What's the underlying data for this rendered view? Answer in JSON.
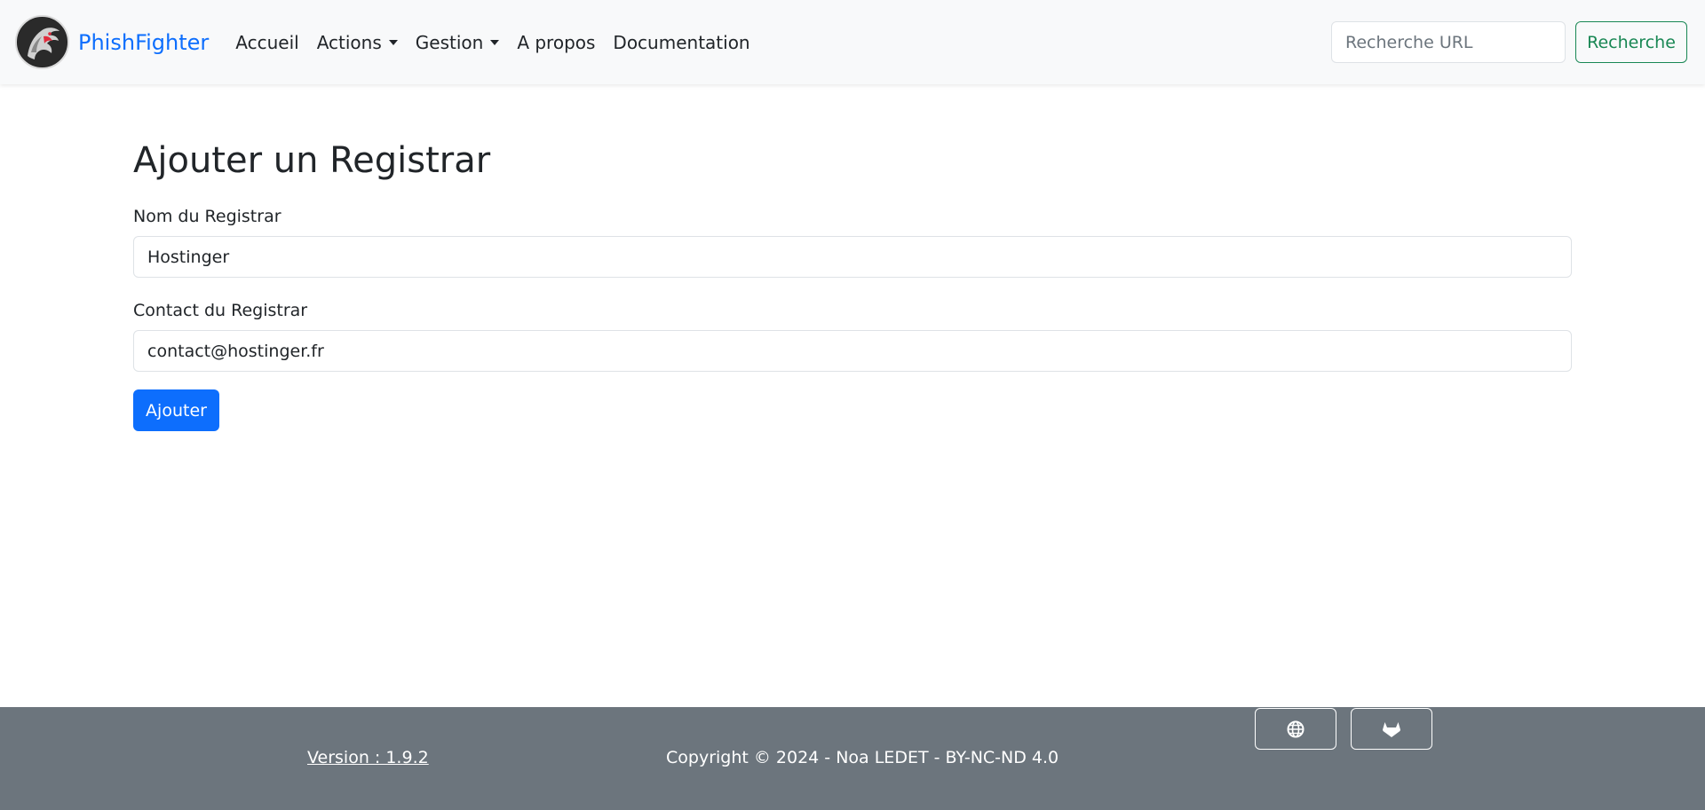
{
  "navbar": {
    "brand": "PhishFighter",
    "logo_icon": "dragon-logo-icon",
    "items": [
      {
        "label": "Accueil",
        "dropdown": false
      },
      {
        "label": "Actions",
        "dropdown": true
      },
      {
        "label": "Gestion",
        "dropdown": true
      },
      {
        "label": "A propos",
        "dropdown": false
      },
      {
        "label": "Documentation",
        "dropdown": false
      }
    ],
    "search_placeholder": "Recherche URL",
    "search_button": "Recherche"
  },
  "page": {
    "title": "Ajouter un Registrar",
    "fields": [
      {
        "label": "Nom du Registrar",
        "value": "Hostinger"
      },
      {
        "label": "Contact du Registrar",
        "value": "contact@hostinger.fr"
      }
    ],
    "submit": "Ajouter"
  },
  "footer": {
    "version": "Version : 1.9.2",
    "copyright": "Copyright © 2024 - Noa LEDET - BY-NC-ND 4.0",
    "buttons": [
      {
        "icon": "globe-icon"
      },
      {
        "icon": "gitlab-icon"
      }
    ]
  },
  "colors": {
    "primary": "#0d6efd",
    "success": "#198754",
    "navbar_bg": "#f8f9fa",
    "footer_bg": "#6c757d"
  }
}
